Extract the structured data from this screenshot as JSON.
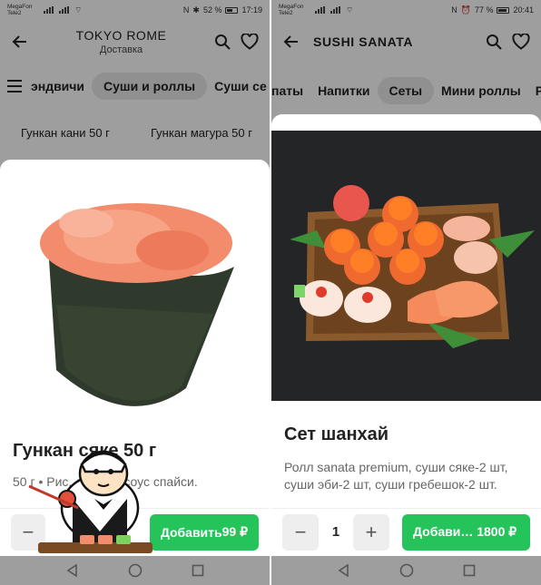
{
  "left": {
    "status": {
      "carrier1": "MegaFon",
      "carrier2": "Tele2",
      "battery": "52 %",
      "time": "17:19"
    },
    "header": {
      "title": "TOKYO ROME",
      "subtitle": "Доставка"
    },
    "categories": [
      "эндвичи",
      "Суши и роллы",
      "Суши се"
    ],
    "cards": [
      "Гункан кани 50 г",
      "Гункан магура 50 г"
    ],
    "product": {
      "name": "Гункан сяке 50 г",
      "desc": "50 г • Рис, лосось, соус спайси.",
      "price_label": "Добавить",
      "price": "99 ₽"
    }
  },
  "right": {
    "status": {
      "carrier1": "MegaFon",
      "carrier2": "Tele2",
      "battery": "77 %",
      "time": "20:41"
    },
    "header": {
      "title": "SUSHI SANATA"
    },
    "categories": [
      "паты",
      "Напитки",
      "Сеты",
      "Мини роллы",
      "Р"
    ],
    "product": {
      "name": "Сет шанхай",
      "desc": "Ролл sanata premium, суши сяке-2 шт, суши эби-2 шт, суши гребешок-2 шт.",
      "qty": "1",
      "price_label": "Добави… 1800 ₽"
    }
  },
  "colors": {
    "accent": "#25c45b",
    "dim": "#5c5c5c"
  }
}
